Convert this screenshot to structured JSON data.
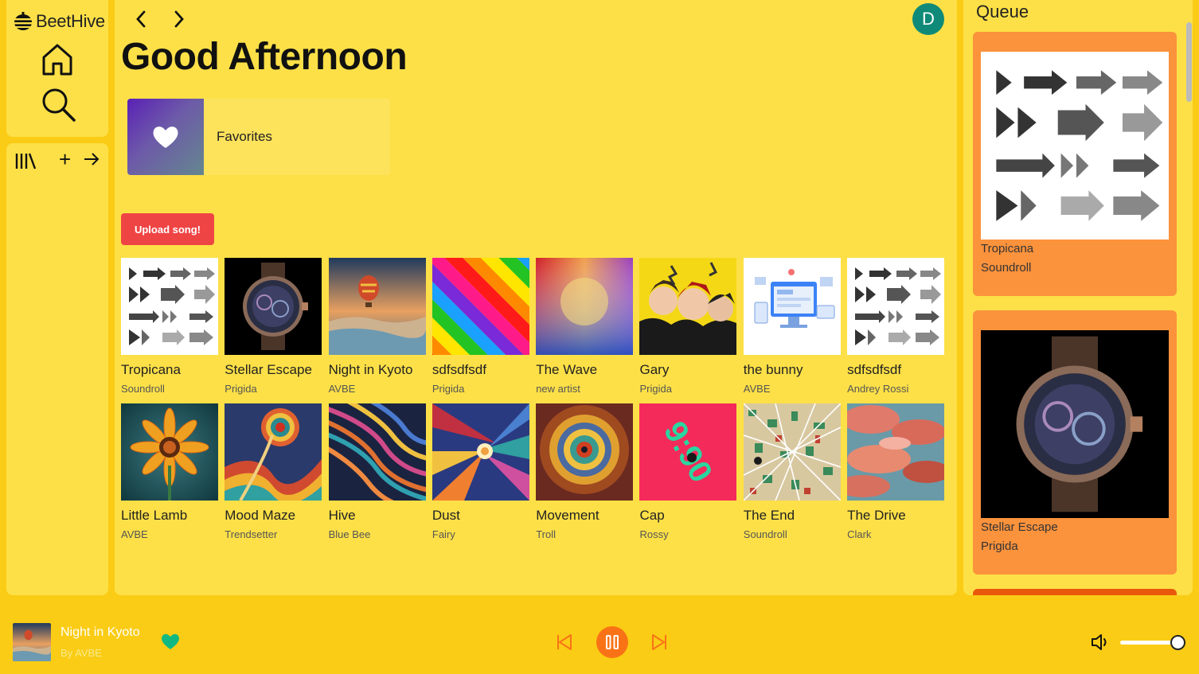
{
  "app": {
    "name": "BeetHive"
  },
  "header": {
    "greeting": "Good Afternoon",
    "avatar_initial": "D"
  },
  "favorites": {
    "label": "Favorites"
  },
  "upload": {
    "label": "Upload song!"
  },
  "songs": [
    {
      "title": "Tropicana",
      "artist": "Soundroll",
      "art": "arrows"
    },
    {
      "title": "Stellar Escape",
      "artist": "Prigida",
      "art": "watch"
    },
    {
      "title": "Night in Kyoto",
      "artist": "AVBE",
      "art": "balloon"
    },
    {
      "title": "sdfsdfsdf",
      "artist": "Prigida",
      "art": "rainbow-stripes"
    },
    {
      "title": "The Wave",
      "artist": "new artist",
      "art": "gradient"
    },
    {
      "title": "Gary",
      "artist": "Prigida",
      "art": "anime"
    },
    {
      "title": "the bunny",
      "artist": "AVBE",
      "art": "web-illustration"
    },
    {
      "title": "sdfsdfsdf",
      "artist": "Andrey Rossi",
      "art": "arrows"
    },
    {
      "title": "Little Lamb",
      "artist": "AVBE",
      "art": "flower"
    },
    {
      "title": "Mood Maze",
      "artist": "Trendsetter",
      "art": "psychedelic-swirl"
    },
    {
      "title": "Hive",
      "artist": "Blue Bee",
      "art": "color-waves"
    },
    {
      "title": "Dust",
      "artist": "Fairy",
      "art": "cosmic-burst"
    },
    {
      "title": "Movement",
      "artist": "Troll",
      "art": "sun-vortex"
    },
    {
      "title": "Cap",
      "artist": "Rossy",
      "art": "pink-990"
    },
    {
      "title": "The End",
      "artist": "Soundroll",
      "art": "mosaic-web"
    },
    {
      "title": "The Drive",
      "artist": "Clark",
      "art": "red-clouds"
    }
  ],
  "queue": {
    "title": "Queue",
    "items": [
      {
        "title": "Tropicana",
        "artist": "Soundroll",
        "art": "arrows"
      },
      {
        "title": "Stellar Escape",
        "artist": "Prigida",
        "art": "watch"
      }
    ]
  },
  "player": {
    "title": "Night in Kyoto",
    "artist": "By AVBE",
    "liked": true,
    "state": "playing",
    "volume": 1.0
  },
  "colors": {
    "background": "#facc15",
    "panel": "#fde047",
    "queue_card": "#fb923c",
    "upload": "#ef4444",
    "play": "#f97316",
    "heart": "#10b981",
    "avatar": "#0f8a78"
  },
  "cap_art_text": "9:90"
}
